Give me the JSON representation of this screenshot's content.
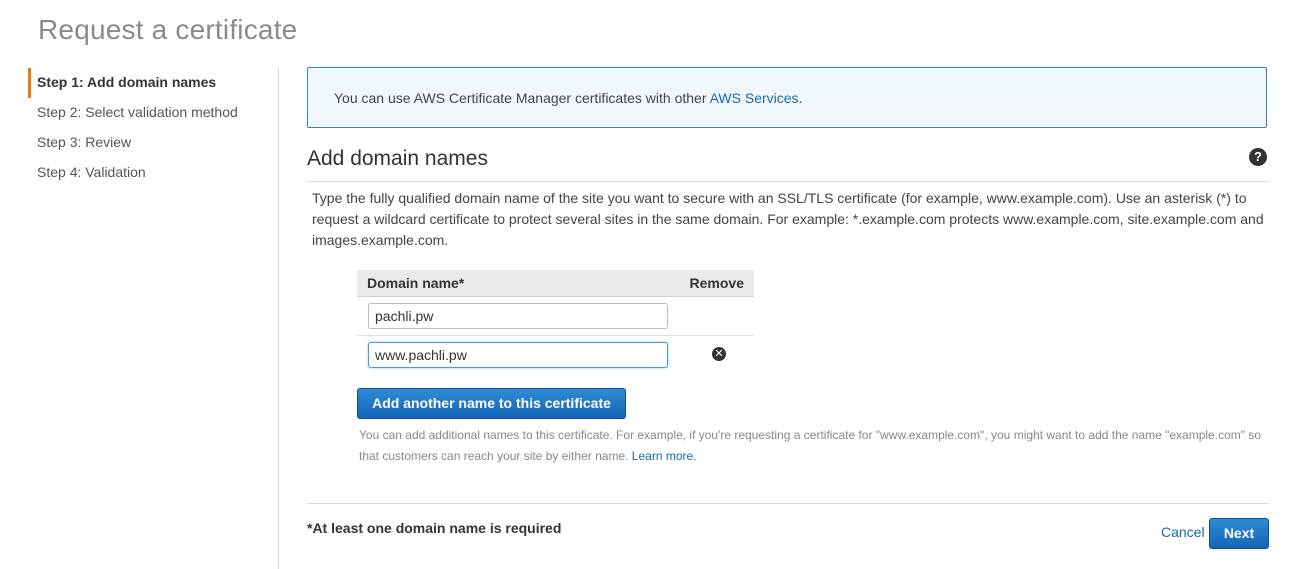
{
  "page": {
    "title": "Request a certificate"
  },
  "steps": [
    {
      "label": "Step 1: Add domain names",
      "active": true
    },
    {
      "label": "Step 2: Select validation method",
      "active": false
    },
    {
      "label": "Step 3: Review",
      "active": false
    },
    {
      "label": "Step 4: Validation",
      "active": false
    }
  ],
  "info": {
    "text": "You can use AWS Certificate Manager certificates with other ",
    "link": "AWS Services",
    "suffix": "."
  },
  "section": {
    "title": "Add domain names",
    "help_icon": "help-icon",
    "description": "Type the fully qualified domain name of the site you want to secure with an SSL/TLS certificate (for example, www.example.com). Use an asterisk (*) to request a wildcard certificate to protect several sites in the same domain. For example: *.example.com protects www.example.com, site.example.com and images.example.com."
  },
  "domains": {
    "header_name": "Domain name*",
    "header_remove": "Remove",
    "rows": [
      {
        "value": "pachli.pw",
        "removable": false
      },
      {
        "value": "www.pachli.pw",
        "removable": true,
        "remove_icon": "close-circle-icon"
      }
    ]
  },
  "add_button": {
    "label": "Add another name to this certificate"
  },
  "hint": {
    "text": "You can add additional names to this certificate. For example, if you're requesting a certificate for \"www.example.com\", you might want to add the name \"example.com\" so that customers can reach your site by either name. ",
    "link": "Learn more."
  },
  "footer": {
    "required_note": "*At least one domain name is required",
    "cancel_label": "Cancel",
    "next_label": "Next"
  },
  "colors": {
    "accent": "#e77b12",
    "primary_button": "#1f74c4",
    "link": "#1a6aa7",
    "info_border": "#2a8ab5"
  }
}
